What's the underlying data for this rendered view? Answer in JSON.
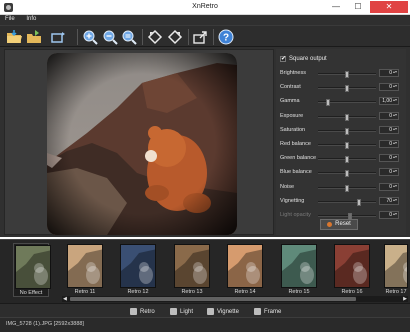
{
  "window": {
    "title": "XnRetro",
    "min_glyph": "—",
    "max_glyph": "☐",
    "close_glyph": "✕"
  },
  "menu": [
    "File",
    "Info"
  ],
  "toolbar": {
    "icons": [
      "open-folder-icon",
      "save-icon",
      "crop-icon",
      "zoom-in-icon",
      "zoom-out-icon",
      "zoom-fit-icon",
      "rotate-left-icon",
      "rotate-right-icon",
      "export-icon",
      "help-icon"
    ],
    "help_glyph": "?"
  },
  "panel": {
    "square_output_label": "Square output",
    "square_output_checked": true,
    "check_glyph": "✔",
    "params": [
      {
        "label": "Brightness",
        "value": "0",
        "level": 0.5
      },
      {
        "label": "Contrast",
        "value": "0",
        "level": 0.5
      },
      {
        "label": "Gamma",
        "value": "1,00",
        "level": 0.18
      },
      {
        "label": "Exposure",
        "value": "0",
        "level": 0.5
      },
      {
        "label": "Saturation",
        "value": "0",
        "level": 0.5
      },
      {
        "label": "Red balance",
        "value": "0",
        "level": 0.5
      },
      {
        "label": "Green balance",
        "value": "0",
        "level": 0.5
      },
      {
        "label": "Blue balance",
        "value": "0",
        "level": 0.5
      },
      {
        "label": "Noise",
        "value": "0",
        "level": 0.5
      },
      {
        "label": "Vignetting",
        "value": "70",
        "level": 0.7
      },
      {
        "label": "Light opacity",
        "value": "0",
        "level": 0.55,
        "disabled": true
      }
    ],
    "reset_label": "Reset"
  },
  "filmstrip": {
    "items": [
      {
        "caption": "No Effect",
        "tint": "#6f7a5a"
      },
      {
        "caption": "Retro 11",
        "tint": "#c9a57e"
      },
      {
        "caption": "Retro 12",
        "tint": "#3a4f73"
      },
      {
        "caption": "Retro 13",
        "tint": "#8a6a4a"
      },
      {
        "caption": "Retro 14",
        "tint": "#d69b6e"
      },
      {
        "caption": "Retro 15",
        "tint": "#5f8a7a"
      },
      {
        "caption": "Retro 16",
        "tint": "#8a3f34"
      },
      {
        "caption": "Retro 17",
        "tint": "#c9b08a"
      }
    ],
    "left_arrow": "◀",
    "right_arrow": "▶"
  },
  "tabs": [
    {
      "label": "Retro",
      "active": true
    },
    {
      "label": "Light",
      "active": false
    },
    {
      "label": "Vignette",
      "active": false
    },
    {
      "label": "Frame",
      "active": false
    }
  ],
  "status": {
    "text": "IMG_5728 (1).JPG [2592x3888]"
  }
}
